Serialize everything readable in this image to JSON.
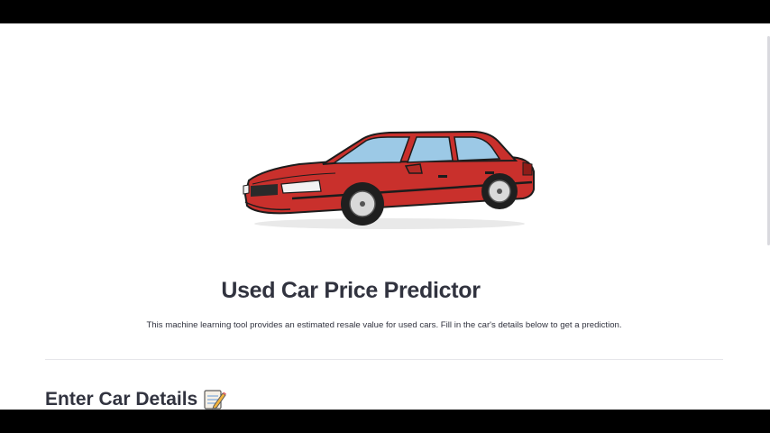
{
  "page": {
    "title": "Used Car Price Predictor",
    "description": "This machine learning tool provides an estimated resale value for used cars. Fill in the car's details below to get a prediction.",
    "hero_image": "red-sedan-illustration"
  },
  "section": {
    "heading": "Enter Car Details",
    "heading_icon": "memo-icon"
  },
  "colors": {
    "text": "#31333f",
    "car_body": "#c9302c",
    "divider": "#e6e6ea",
    "background": "#ffffff"
  }
}
